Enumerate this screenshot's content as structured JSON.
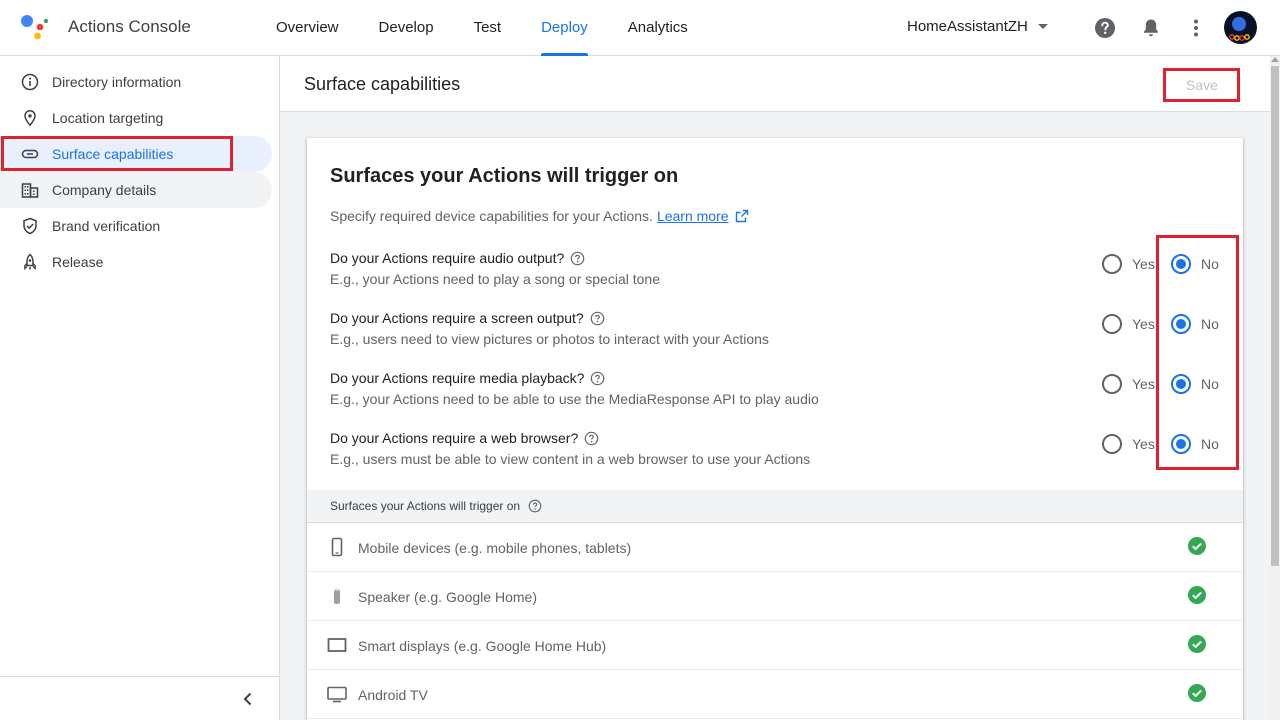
{
  "app": {
    "title": "Actions Console"
  },
  "nav": {
    "tabs": [
      {
        "label": "Overview",
        "active": false
      },
      {
        "label": "Develop",
        "active": false
      },
      {
        "label": "Test",
        "active": false
      },
      {
        "label": "Deploy",
        "active": true
      },
      {
        "label": "Analytics",
        "active": false
      }
    ]
  },
  "project": {
    "name": "HomeAssistantZH"
  },
  "icons": {
    "help": "help-circle-icon",
    "notifications": "bell-icon",
    "more": "more-vert-icon"
  },
  "sidebar": {
    "items": [
      {
        "label": "Directory information",
        "icon": "info-icon"
      },
      {
        "label": "Location targeting",
        "icon": "location-pin-icon"
      },
      {
        "label": "Surface capabilities",
        "icon": "link-icon",
        "selected": true
      },
      {
        "label": "Company details",
        "icon": "building-icon"
      },
      {
        "label": "Brand verification",
        "icon": "shield-check-icon"
      },
      {
        "label": "Release",
        "icon": "rocket-icon"
      }
    ]
  },
  "page": {
    "title": "Surface capabilities",
    "save_label": "Save",
    "card": {
      "title": "Surfaces your Actions will trigger on",
      "description": "Specify required device capabilities for your Actions.",
      "learn_more": "Learn more",
      "questions": [
        {
          "title": "Do your Actions require audio output?",
          "subtitle": "E.g., your Actions need to play a song or special tone",
          "yes": "Yes",
          "no": "No",
          "value": "No"
        },
        {
          "title": "Do your Actions require a screen output?",
          "subtitle": "E.g., users need to view pictures or photos to interact with your Actions",
          "yes": "Yes",
          "no": "No",
          "value": "No"
        },
        {
          "title": "Do your Actions require media playback?",
          "subtitle": "E.g., your Actions need to be able to use the MediaResponse API to play audio",
          "yes": "Yes",
          "no": "No",
          "value": "No"
        },
        {
          "title": "Do your Actions require a web browser?",
          "subtitle": "E.g., users must be able to view content in a web browser to use your Actions",
          "yes": "Yes",
          "no": "No",
          "value": "No"
        }
      ],
      "surfaces_header": "Surfaces your Actions will trigger on",
      "surfaces": [
        {
          "name": "Mobile devices (e.g. mobile phones, tablets)",
          "icon": "smartphone-icon",
          "supported": true
        },
        {
          "name": "Speaker (e.g. Google Home)",
          "icon": "speaker-icon",
          "supported": true
        },
        {
          "name": "Smart displays (e.g. Google Home Hub)",
          "icon": "smart-display-icon",
          "supported": true
        },
        {
          "name": "Android TV",
          "icon": "tv-icon",
          "supported": true
        }
      ]
    }
  },
  "colors": {
    "accent": "#1a73e8",
    "success": "#34a853",
    "highlight": "#e0222d"
  }
}
